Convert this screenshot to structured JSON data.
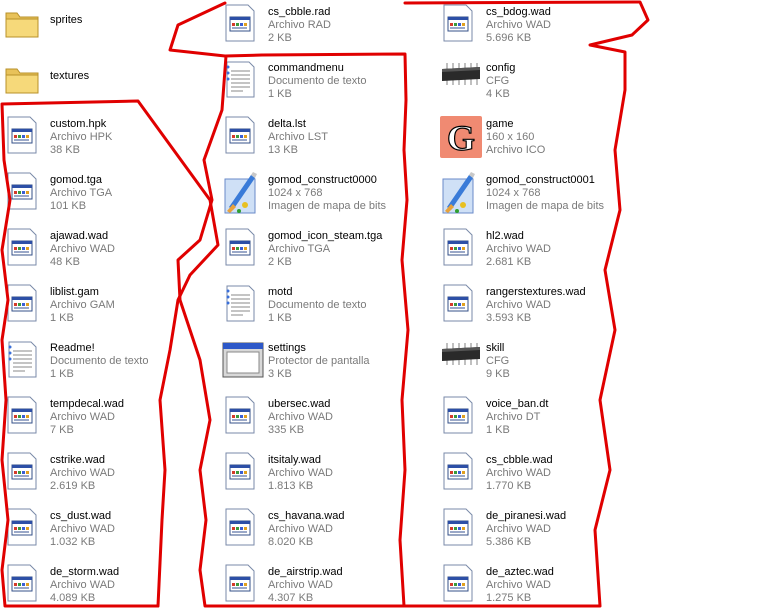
{
  "files": [
    {
      "name": "sprites",
      "l1": "",
      "l2": "",
      "icon": "folder-icon"
    },
    {
      "name": "textures",
      "l1": "",
      "l2": "",
      "icon": "folder-icon"
    },
    {
      "name": "custom.hpk",
      "l1": "Archivo HPK",
      "l2": "38 KB",
      "icon": "generic-file-icon"
    },
    {
      "name": "gomod.tga",
      "l1": "Archivo TGA",
      "l2": "101 KB",
      "icon": "generic-file-icon"
    },
    {
      "name": "ajawad.wad",
      "l1": "Archivo WAD",
      "l2": "48 KB",
      "icon": "generic-file-icon"
    },
    {
      "name": "liblist.gam",
      "l1": "Archivo GAM",
      "l2": "1 KB",
      "icon": "generic-file-icon"
    },
    {
      "name": "Readme!",
      "l1": "Documento de texto",
      "l2": "1 KB",
      "icon": "text-document-icon"
    },
    {
      "name": "tempdecal.wad",
      "l1": "Archivo WAD",
      "l2": "7 KB",
      "icon": "generic-file-icon"
    },
    {
      "name": "cstrike.wad",
      "l1": "Archivo WAD",
      "l2": "2.619 KB",
      "icon": "generic-file-icon"
    },
    {
      "name": "cs_dust.wad",
      "l1": "Archivo WAD",
      "l2": "1.032 KB",
      "icon": "generic-file-icon"
    },
    {
      "name": "de_storm.wad",
      "l1": "Archivo WAD",
      "l2": "4.089 KB",
      "icon": "generic-file-icon"
    },
    {
      "name": "cs_cbble.rad",
      "l1": "Archivo RAD",
      "l2": "2 KB",
      "icon": "generic-file-icon"
    },
    {
      "name": "commandmenu",
      "l1": "Documento de texto",
      "l2": "1 KB",
      "icon": "text-document-icon"
    },
    {
      "name": "delta.lst",
      "l1": "Archivo LST",
      "l2": "13 KB",
      "icon": "generic-file-icon"
    },
    {
      "name": "gomod_construct0000",
      "l1": "1024 x 768",
      "l2": "Imagen de mapa de bits",
      "icon": "paint-bitmap-icon"
    },
    {
      "name": "gomod_icon_steam.tga",
      "l1": "Archivo TGA",
      "l2": "2 KB",
      "icon": "generic-file-icon"
    },
    {
      "name": "motd",
      "l1": "Documento de texto",
      "l2": "1 KB",
      "icon": "text-document-icon"
    },
    {
      "name": "settings",
      "l1": "Protector de pantalla",
      "l2": "3 KB",
      "icon": "screensaver-icon"
    },
    {
      "name": "ubersec.wad",
      "l1": "Archivo WAD",
      "l2": "335 KB",
      "icon": "generic-file-icon"
    },
    {
      "name": "itsitaly.wad",
      "l1": "Archivo WAD",
      "l2": "1.813 KB",
      "icon": "generic-file-icon"
    },
    {
      "name": "cs_havana.wad",
      "l1": "Archivo WAD",
      "l2": "8.020 KB",
      "icon": "generic-file-icon"
    },
    {
      "name": "de_airstrip.wad",
      "l1": "Archivo WAD",
      "l2": "4.307 KB",
      "icon": "generic-file-icon"
    },
    {
      "name": "cs_bdog.wad",
      "l1": "Archivo WAD",
      "l2": "5.696 KB",
      "icon": "generic-file-icon"
    },
    {
      "name": "config",
      "l1": "CFG",
      "l2": "4 KB",
      "icon": "chip-config-icon"
    },
    {
      "name": "game",
      "l1": "160 x 160",
      "l2": "Archivo ICO",
      "icon": "game-g-icon"
    },
    {
      "name": "gomod_construct0001",
      "l1": "1024 x 768",
      "l2": "Imagen de mapa de bits",
      "icon": "paint-bitmap-icon"
    },
    {
      "name": "hl2.wad",
      "l1": "Archivo WAD",
      "l2": "2.681 KB",
      "icon": "generic-file-icon"
    },
    {
      "name": "rangerstextures.wad",
      "l1": "Archivo WAD",
      "l2": "3.593 KB",
      "icon": "generic-file-icon"
    },
    {
      "name": "skill",
      "l1": "CFG",
      "l2": "9 KB",
      "icon": "chip-config-icon"
    },
    {
      "name": "voice_ban.dt",
      "l1": "Archivo DT",
      "l2": "1 KB",
      "icon": "generic-file-icon"
    },
    {
      "name": "cs_cbble.wad",
      "l1": "Archivo WAD",
      "l2": "1.770 KB",
      "icon": "generic-file-icon"
    },
    {
      "name": "de_piranesi.wad",
      "l1": "Archivo WAD",
      "l2": "5.386 KB",
      "icon": "generic-file-icon"
    },
    {
      "name": "de_aztec.wad",
      "l1": "Archivo WAD",
      "l2": "1.275 KB",
      "icon": "generic-file-icon"
    }
  ],
  "colors": {
    "annotation_red": "#e00000",
    "secondary_text": "#7a7a7a"
  }
}
